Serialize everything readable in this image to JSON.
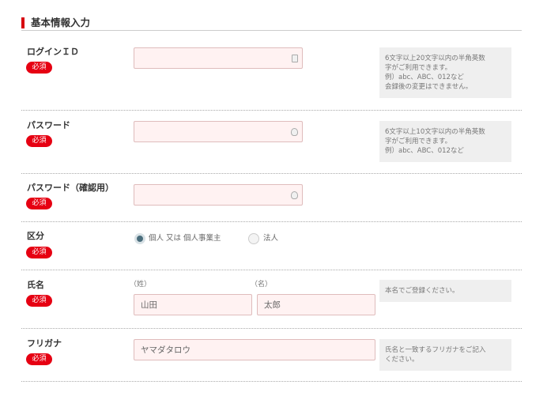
{
  "section": {
    "title": "基本情報入力"
  },
  "required_label": "必須",
  "login_id": {
    "label": "ログインＩＤ",
    "value": "",
    "hint": [
      "6文字以上20文字以内の半角英数",
      "字がご利用できます。",
      "例）abc、ABC、012など",
      "会録後の変更はできません。"
    ]
  },
  "password": {
    "label": "パスワード",
    "value": "",
    "hint": [
      "6文字以上10文字以内の半角英数",
      "字がご利用できます。",
      "例）abc、ABC、012など"
    ]
  },
  "password_confirm": {
    "label": "パスワード（確認用）",
    "value": ""
  },
  "category": {
    "label": "区分",
    "options": [
      {
        "label": "個人 又は 個人事業主",
        "checked": true
      },
      {
        "label": "法人",
        "checked": false
      }
    ]
  },
  "name": {
    "label": "氏名",
    "last_label": "（姓）",
    "first_label": "（名）",
    "last_placeholder": "山田",
    "first_placeholder": "太郎",
    "hint": [
      "本名でご登録ください。"
    ]
  },
  "furigana": {
    "label": "フリガナ",
    "placeholder": "ヤマダタロウ",
    "hint": [
      "氏名と一致するフリガナをご記入",
      "ください。"
    ]
  }
}
